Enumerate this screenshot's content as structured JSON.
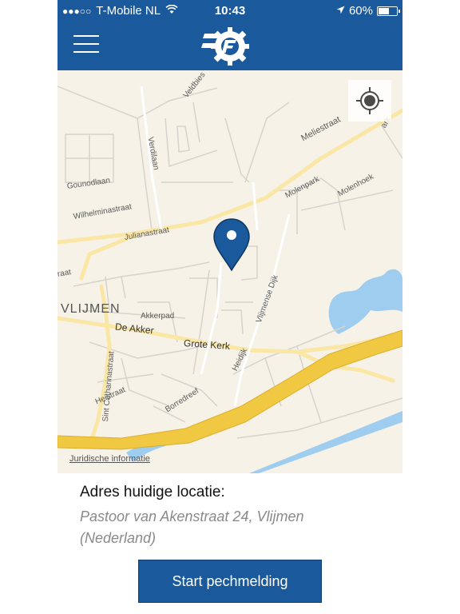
{
  "status_bar": {
    "carrier": "T-Mobile NL",
    "signal": "●●●○○",
    "time": "10:43",
    "battery": "60%",
    "battery_level": 0.6
  },
  "header": {
    "menu_icon": "hamburger-menu-icon",
    "logo_icon": "gear-f-logo-icon"
  },
  "map": {
    "street_labels": {
      "veldbies": "Veldbies",
      "verdilaan": "Verdilaan",
      "gounodlaan": "Gounodlaan",
      "wilhelminastraat": "Wilhelminastraat",
      "julianastraat": "Julianastraat",
      "meliestraat": "Meliestraat",
      "molenpark": "Molenpark",
      "molenhoek": "Molenhoek",
      "vlijmense_dijk": "Vlijmense Dijk",
      "akkerpad": "Akkerpad",
      "de_akker": "De Akker",
      "grote_kerk": "Grote Kerk",
      "heidijk": "Heidijk",
      "borredreef": "Borredreef",
      "heistraat": "Heistraat",
      "sint_catharinastraat": "Sint Catharinastraat",
      "edge_left": "raat",
      "edge_right": "ark"
    },
    "town_label": "VLIJMEN",
    "legal_link": "Juridische informatie",
    "locate_icon": "crosshair-locate-icon",
    "pin_icon": "map-pin-icon"
  },
  "location": {
    "title": "Adres huidige locatie:",
    "address": "Pastoor van Akenstraat 24, Vlijmen (Nederland)"
  },
  "actions": {
    "start_label": "Start pechmelding"
  }
}
